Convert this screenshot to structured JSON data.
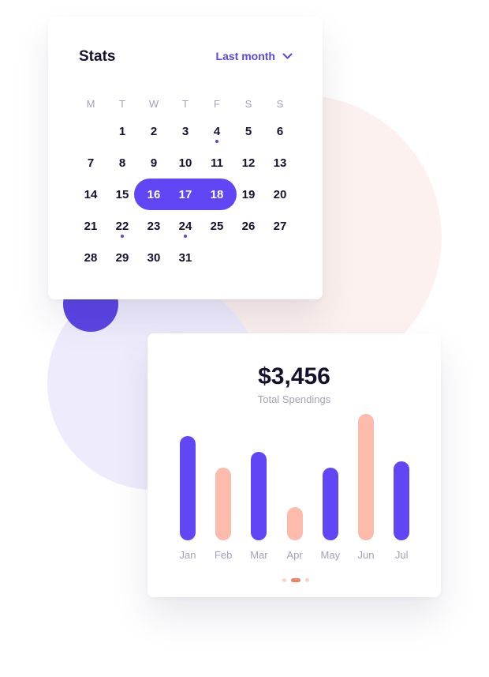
{
  "calendar": {
    "title": "Stats",
    "range_label": "Last month",
    "weekdays": [
      "M",
      "T",
      "W",
      "T",
      "F",
      "S",
      "S"
    ],
    "days": [
      {
        "n": "1"
      },
      {
        "n": "2"
      },
      {
        "n": "3"
      },
      {
        "n": "4",
        "dot": true
      },
      {
        "n": "5"
      },
      {
        "n": "6"
      },
      {
        "n": "7"
      },
      {
        "n": "8"
      },
      {
        "n": "9"
      },
      {
        "n": "10"
      },
      {
        "n": "11"
      },
      {
        "n": "12"
      },
      {
        "n": "13"
      },
      {
        "n": "14"
      },
      {
        "n": "15"
      },
      {
        "n": "16",
        "selected": true
      },
      {
        "n": "17",
        "selected": true
      },
      {
        "n": "18",
        "selected": true
      },
      {
        "n": "19"
      },
      {
        "n": "20"
      },
      {
        "n": "21"
      },
      {
        "n": "22",
        "dot": true
      },
      {
        "n": "23"
      },
      {
        "n": "24",
        "dot": true
      },
      {
        "n": "25"
      },
      {
        "n": "26"
      },
      {
        "n": "27"
      },
      {
        "n": "28"
      },
      {
        "n": "29"
      },
      {
        "n": "30"
      },
      {
        "n": "31"
      }
    ],
    "first_weekday_index": 1
  },
  "spendings": {
    "amount": "$3,456",
    "label": "Total Spendings",
    "pager": {
      "count": 3,
      "active": 1
    }
  },
  "chart_data": {
    "type": "bar",
    "categories": [
      "Jan",
      "Feb",
      "Mar",
      "Apr",
      "May",
      "Jun",
      "Jul"
    ],
    "values": [
      132,
      92,
      112,
      42,
      92,
      160,
      100
    ],
    "colors": [
      "#6046f5",
      "#fdbcab",
      "#6046f5",
      "#fdbcab",
      "#6046f5",
      "#fdbcab",
      "#6046f5"
    ],
    "title": "",
    "xlabel": "",
    "ylabel": "",
    "ylim": [
      0,
      160
    ],
    "grid": false
  },
  "colors": {
    "accent": "#6046f5",
    "peach": "#fdbcab",
    "text": "#15112e",
    "muted": "#a3a1b7",
    "pager_inactive": "#fbd3cb",
    "pager_active": "#ee8266"
  },
  "icons": {
    "range_toggle": "chevron-down-icon"
  }
}
